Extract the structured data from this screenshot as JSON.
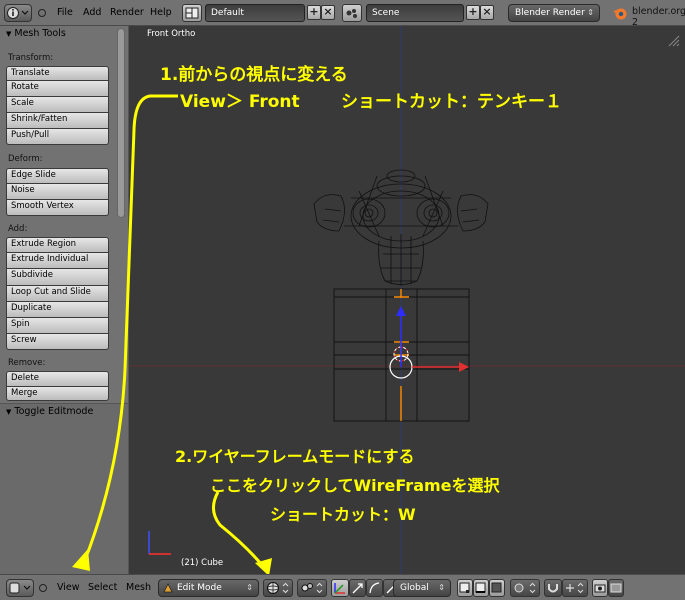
{
  "header": {
    "menus": [
      "File",
      "Add",
      "Render",
      "Help"
    ],
    "screen_layout": "Default",
    "scene": "Scene",
    "render_engine": "Blender Render",
    "website": "blender.org 2"
  },
  "toolshelf": {
    "panel_title": "Mesh Tools",
    "sections": [
      {
        "label": "Transform:",
        "buttons": [
          "Translate",
          "Rotate",
          "Scale",
          "Shrink/Fatten",
          "Push/Pull"
        ]
      },
      {
        "label": "Deform:",
        "buttons": [
          "Edge Slide",
          "Noise",
          "Smooth Vertex"
        ]
      },
      {
        "label": "Add:",
        "buttons": [
          "Extrude Region",
          "Extrude Individual",
          "Subdivide",
          "Loop Cut and Slide",
          "Duplicate",
          "Spin",
          "Screw"
        ]
      },
      {
        "label": "Remove:",
        "buttons": [
          "Delete",
          "Merge"
        ]
      }
    ],
    "operator_panel_title": "Toggle Editmode"
  },
  "viewport": {
    "view_name": "Front Ortho",
    "object_info": "(21) Cube"
  },
  "annotations": {
    "step1_title": "1.前からの視点に変える",
    "step1_menu": "View＞ Front",
    "step1_shortcut": "ショートカット：テンキー１",
    "step2_title": "2.ワイヤーフレームモードにする",
    "step2_action": "ここをクリックしてWireFrameを選択",
    "step2_shortcut": "ショートカット：W",
    "annotation_color": "#ffff00"
  },
  "footer": {
    "menus": [
      "View",
      "Select",
      "Mesh"
    ],
    "mode": "Edit Mode",
    "orientation": "Global"
  },
  "colors": {
    "header_bg": "#727272",
    "viewport_bg": "#393939",
    "annotation": "#ffff00",
    "edge_orange": "#ff8c00",
    "axis_red": "#e03030",
    "axis_blue": "#3030ff"
  }
}
